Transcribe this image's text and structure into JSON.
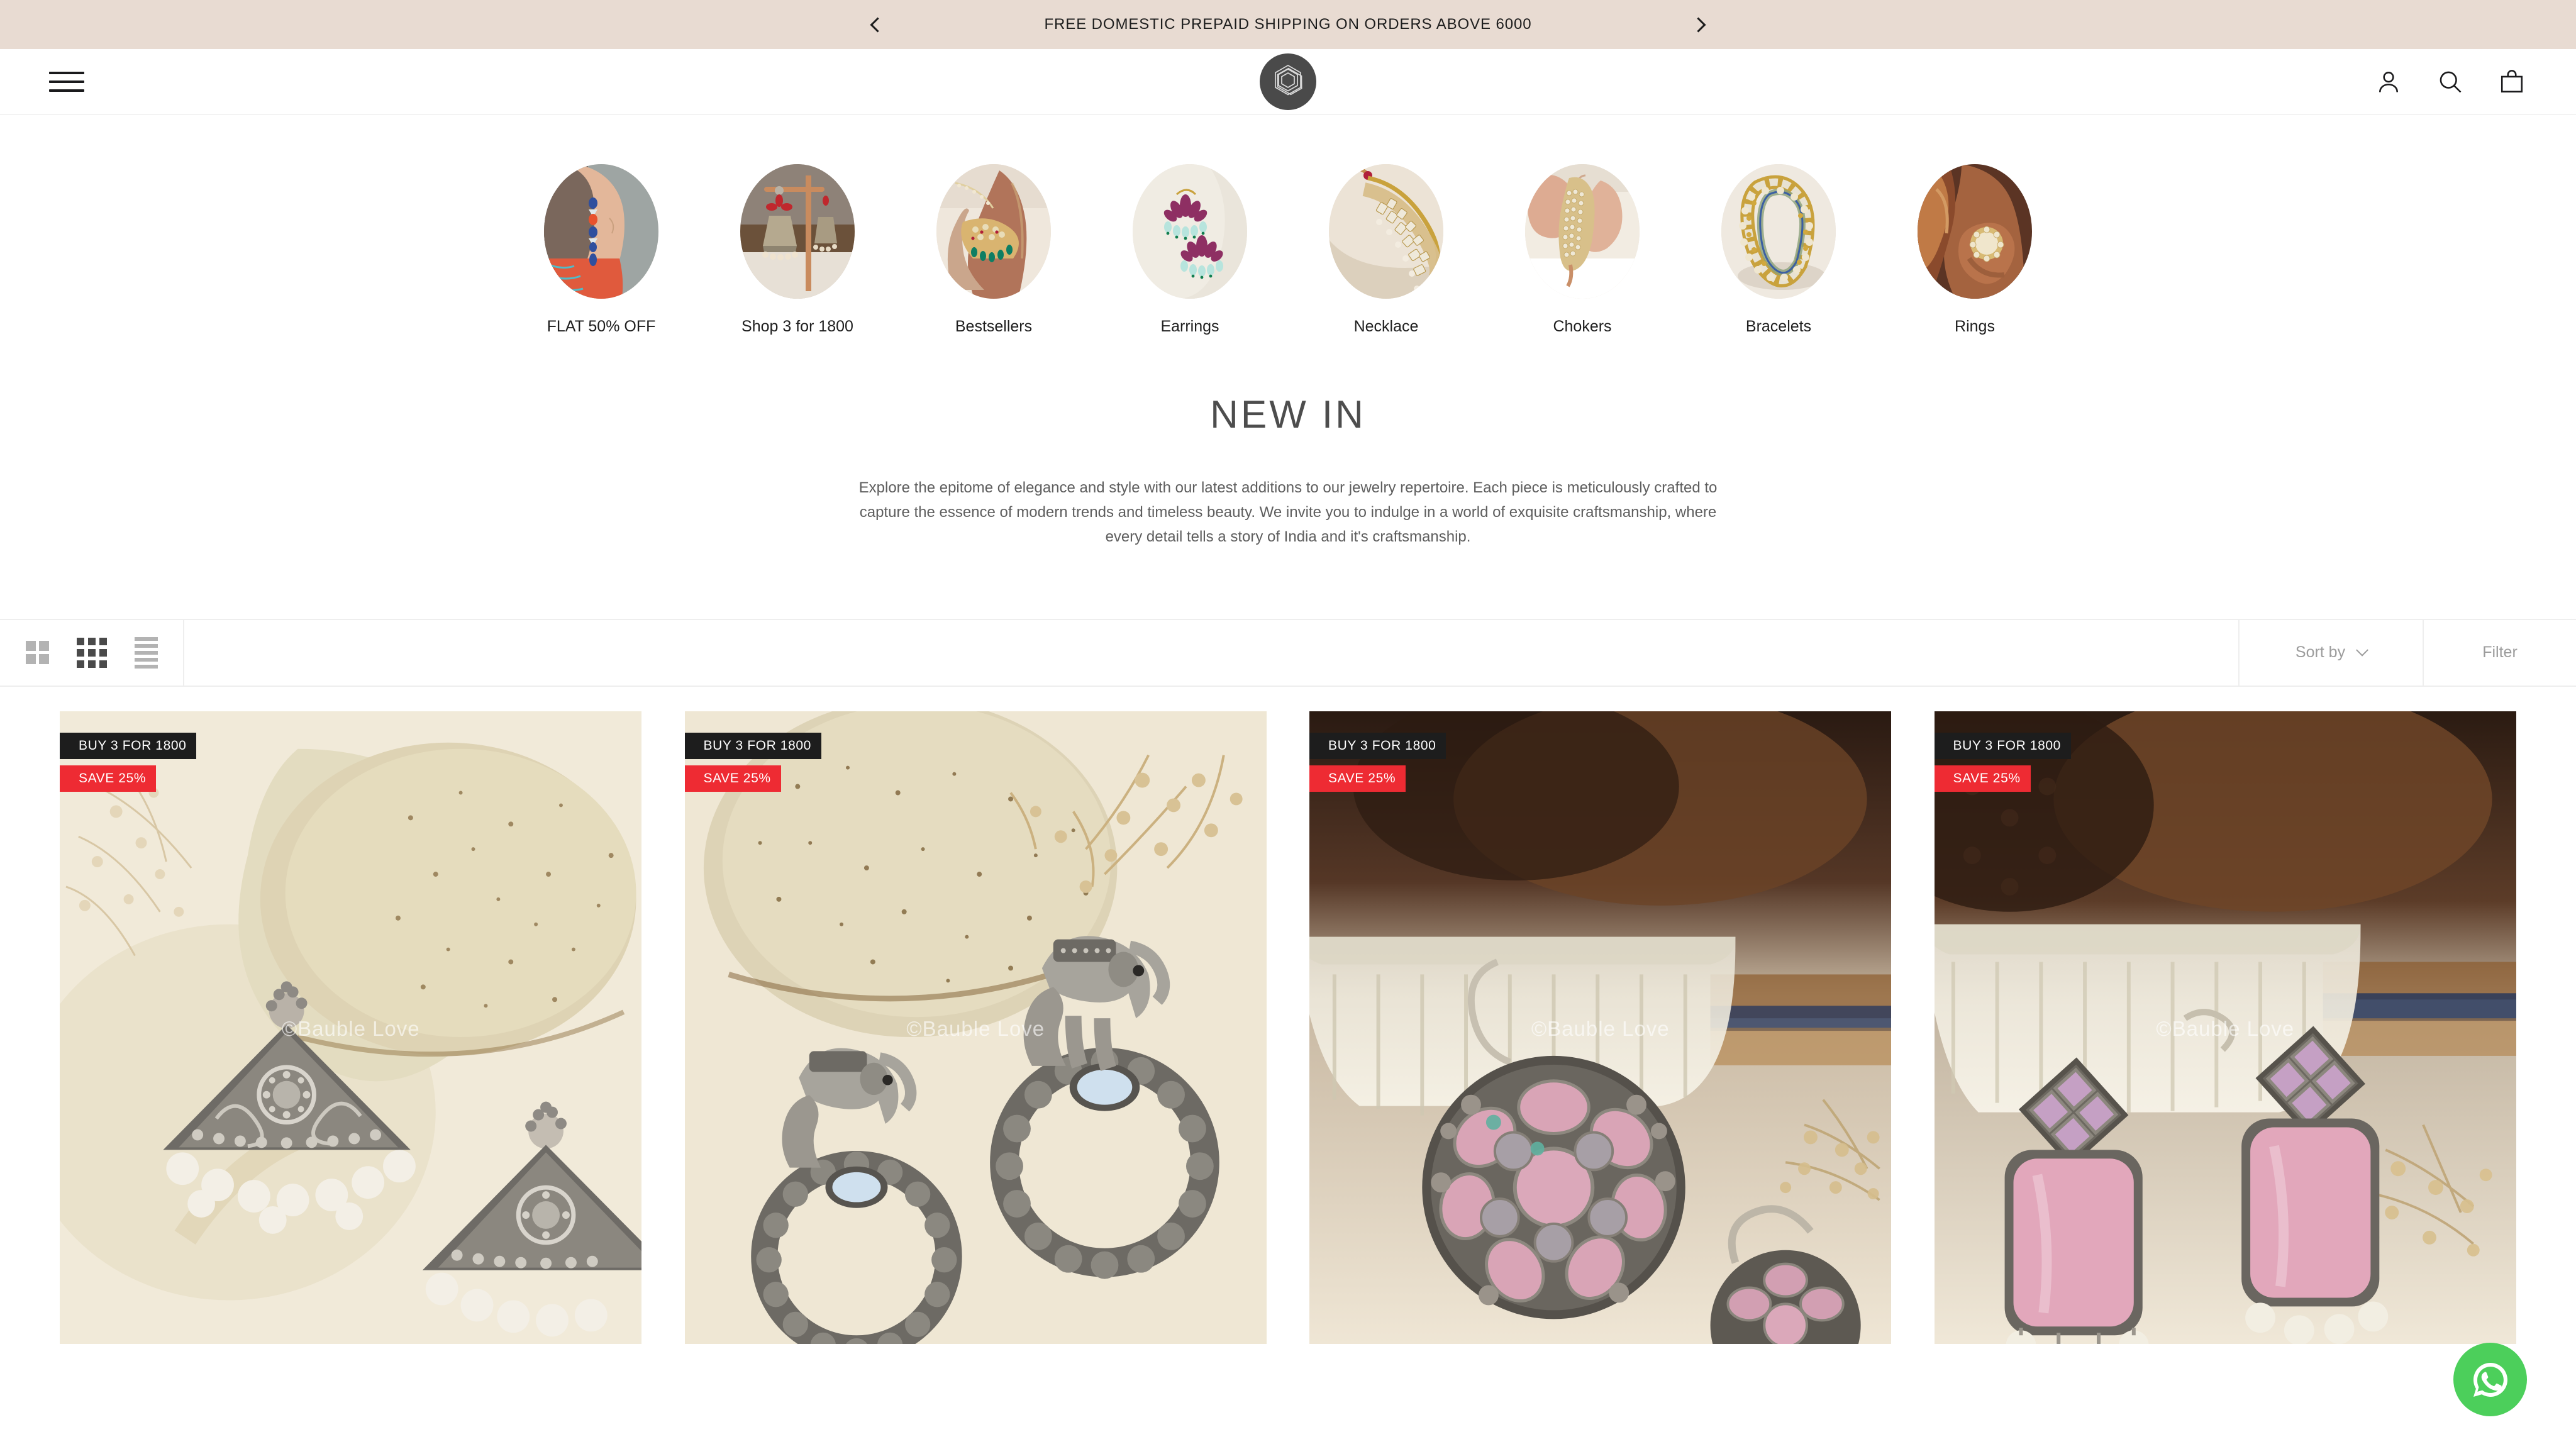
{
  "announcement": {
    "text": "FREE DOMESTIC PREPAID SHIPPING ON ORDERS ABOVE 6000",
    "prev_label": "Previous announcement",
    "next_label": "Next announcement",
    "background": "#E8DBD2"
  },
  "header": {
    "menu_label": "Menu",
    "logo_label": "Bauble Love",
    "account_label": "Account",
    "search_label": "Search",
    "cart_label": "Cart"
  },
  "categories": [
    {
      "label": "FLAT 50% OFF"
    },
    {
      "label": "Shop 3 for 1800"
    },
    {
      "label": "Bestsellers"
    },
    {
      "label": "Earrings"
    },
    {
      "label": "Necklace"
    },
    {
      "label": "Chokers"
    },
    {
      "label": "Bracelets"
    },
    {
      "label": "Rings"
    }
  ],
  "collection": {
    "title": "NEW IN",
    "description": "Explore the epitome of elegance and style with our latest additions to our jewelry repertoire. Each piece is meticulously crafted to capture the essence of modern trends and timeless beauty. We invite you to indulge in a world of exquisite craftsmanship, where every detail tells a story of India and it's craftsmanship."
  },
  "toolbar": {
    "view_grid_2_label": "Switch to 2 column grid",
    "view_grid_3_label": "Switch to 3 column grid",
    "view_list_label": "Switch to list view",
    "active_view": "grid-3",
    "sort_label": "Sort by",
    "filter_label": "Filter"
  },
  "products": [
    {
      "badge_deal": "BUY 3 FOR 1800",
      "badge_save": "SAVE 25%",
      "watermark": "©Bauble Love"
    },
    {
      "badge_deal": "BUY 3 FOR 1800",
      "badge_save": "SAVE 25%",
      "watermark": "©Bauble Love"
    },
    {
      "badge_deal": "BUY 3 FOR 1800",
      "badge_save": "SAVE 25%",
      "watermark": "©Bauble Love"
    },
    {
      "badge_deal": "BUY 3 FOR 1800",
      "badge_save": "SAVE 25%",
      "watermark": "©Bauble Love"
    }
  ],
  "floating_action": {
    "label": "Chat on WhatsApp",
    "color": "#4CCF5B"
  }
}
